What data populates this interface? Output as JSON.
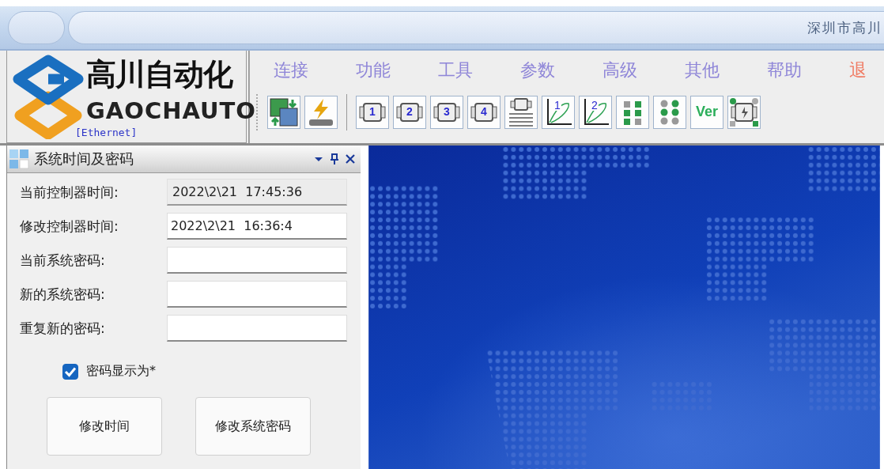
{
  "window": {
    "title": "深圳市高川"
  },
  "logo": {
    "name": "高川自动化",
    "latin": "GAOCHAUTO",
    "connection": "[Ethernet]"
  },
  "menu": [
    {
      "label": "连接",
      "kind": "normal"
    },
    {
      "label": "功能",
      "kind": "normal"
    },
    {
      "label": "工具",
      "kind": "normal"
    },
    {
      "label": "参数",
      "kind": "normal"
    },
    {
      "label": "高级",
      "kind": "normal"
    },
    {
      "label": "其他",
      "kind": "normal"
    },
    {
      "label": "帮助",
      "kind": "normal"
    },
    {
      "label": "退",
      "kind": "exit"
    }
  ],
  "toolbar": [
    {
      "kind": "copy"
    },
    {
      "kind": "flash"
    },
    {
      "kind": "motor",
      "label": "1"
    },
    {
      "kind": "motor",
      "label": "2"
    },
    {
      "kind": "motor",
      "label": "3"
    },
    {
      "kind": "motor",
      "label": "4"
    },
    {
      "kind": "motor-doc"
    },
    {
      "kind": "curve",
      "label": "1"
    },
    {
      "kind": "curve",
      "label": "2"
    },
    {
      "kind": "grid"
    },
    {
      "kind": "dots"
    },
    {
      "kind": "ver",
      "label": "Ver"
    },
    {
      "kind": "motor-io"
    }
  ],
  "panel": {
    "title": "系统时间及密码",
    "fields": [
      {
        "label": "当前控制器时间:",
        "value": "2022\\2\\21  17:45:36",
        "disabled": true
      },
      {
        "label": "修改控制器时间:",
        "value": "2022\\2\\21  16:36:4",
        "disabled": false
      },
      {
        "label": "当前系统密码:",
        "disabled": false
      },
      {
        "label": "新的系统密码:",
        "disabled": false
      },
      {
        "label": "重复新的密码:",
        "disabled": false
      }
    ],
    "mask_password": {
      "label": "密码显示为*",
      "checked": true
    },
    "buttons": [
      "修改时间",
      "修改系统密码"
    ]
  }
}
